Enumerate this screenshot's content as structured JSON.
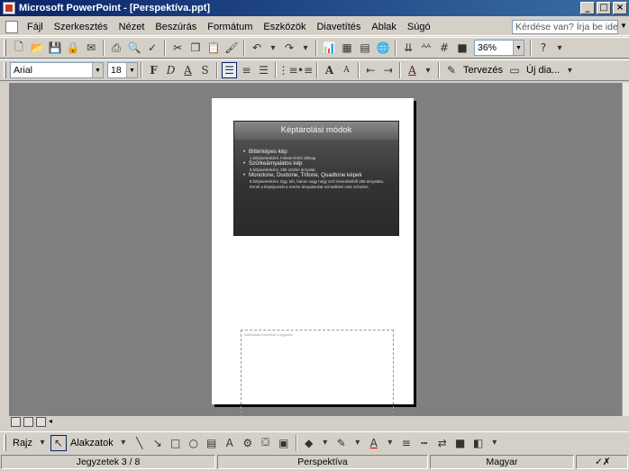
{
  "window": {
    "title": "Microsoft PowerPoint - [Perspektíva.ppt]",
    "controls": {
      "minimize": "_",
      "restore": "□",
      "close": "×"
    }
  },
  "menubar": {
    "items": [
      {
        "label": "Fájl"
      },
      {
        "label": "Szerkesztés"
      },
      {
        "label": "Nézet"
      },
      {
        "label": "Beszúrás"
      },
      {
        "label": "Formátum"
      },
      {
        "label": "Eszközök"
      },
      {
        "label": "Diavetítés"
      },
      {
        "label": "Ablak"
      },
      {
        "label": "Súgó"
      }
    ],
    "help_placeholder": "Kérdése van? Írja be ide."
  },
  "standard_toolbar": {
    "icons": [
      "new-icon",
      "open-icon",
      "save-icon",
      "permission-icon",
      "email-icon",
      "print-icon",
      "print-preview-icon",
      "spelling-icon",
      "cut-icon",
      "copy-icon",
      "paste-icon",
      "format-painter-icon",
      "undo-icon",
      "redo-icon",
      "insert-chart-icon",
      "insert-table-icon",
      "tables-borders-icon",
      "hyperlink-icon",
      "expand-all-icon",
      "show-formatting-icon",
      "grid-icon",
      "color-grayscale-icon",
      "help-icon"
    ],
    "zoom": "36%"
  },
  "formatting_toolbar": {
    "font": "Arial",
    "font_size": "18",
    "bold": "F",
    "italic": "D",
    "underline": "A",
    "shadow": "S",
    "design_label": "Tervezés",
    "new_slide_label": "Új dia..."
  },
  "slide": {
    "title": "Képtárolási módok",
    "bullets": [
      {
        "head": "Bittérképes kép",
        "sub": "1 bit/pixelenként. Fekete-fehér állmap."
      },
      {
        "head": "Szürkeárnyalatos kép",
        "sub": "8 bit/pixelenként. 256 szürke árnyalat."
      },
      {
        "head": "Monotone, Duotone, Tritone, Quadtone képek",
        "sub": "8 bit/pixelenként. Egy, két, három vagy négy szín keverékéből 256 árnyalata. Ennél a képtípusnál a szürke árnyalatokat színtelikkel más színekre."
      }
    ]
  },
  "notes": {
    "placeholder": "Kattintással felvehetők a jegyzetek"
  },
  "drawing_toolbar": {
    "draw_label": "Rajz",
    "autoshapes_label": "Alakzatok"
  },
  "statusbar": {
    "page": "Jegyzetek 3 / 8",
    "design": "Perspektíva",
    "language": "Magyar"
  },
  "colors": {
    "titlebar_start": "#0a246a",
    "titlebar_end": "#3a6ea5",
    "workspace": "#7f7f7f",
    "chrome": "#d4d0c8"
  }
}
